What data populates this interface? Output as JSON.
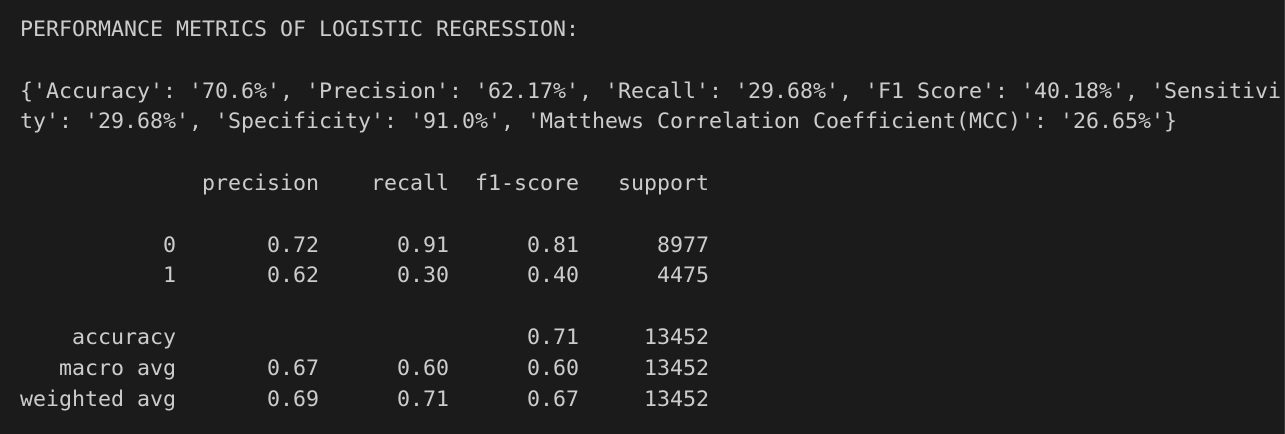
{
  "output": {
    "lines": [
      "PERFORMANCE METRICS OF LOGISTIC REGRESSION:",
      "",
      "{'Accuracy': '70.6%', 'Precision': '62.17%', 'Recall': '29.68%', 'F1 Score': '40.18%', 'Sensitivi",
      "ty': '29.68%', 'Specificity': '91.0%', 'Matthews Correlation Coefficient(MCC)': '26.65%'}",
      "",
      "              precision    recall  f1-score   support",
      "",
      "           0       0.72      0.91      0.81      8977",
      "           1       0.62      0.30      0.40      4475",
      "",
      "    accuracy                           0.71     13452",
      "   macro avg       0.67      0.60      0.60     13452",
      "weighted avg       0.69      0.71      0.67     13452"
    ]
  }
}
